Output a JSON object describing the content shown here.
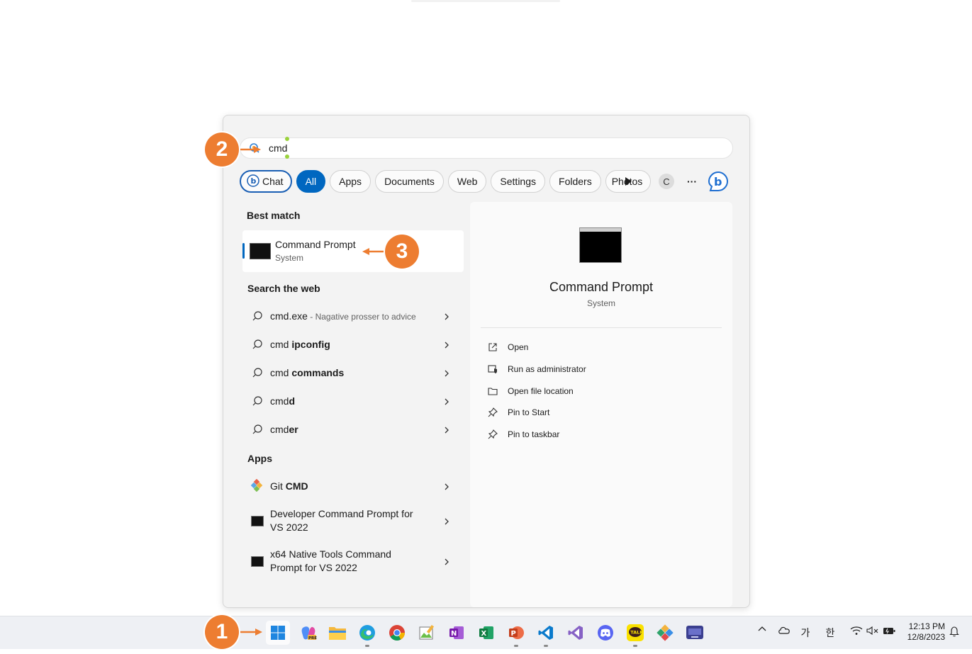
{
  "search": {
    "value": "cmd"
  },
  "filters": {
    "chat": "Chat",
    "items": [
      "All",
      "Apps",
      "Documents",
      "Web",
      "Settings",
      "Folders",
      "Photos"
    ],
    "extra_letter": "C",
    "more": "···"
  },
  "best_match": {
    "heading": "Best match",
    "title": "Command Prompt",
    "subtitle": "System"
  },
  "web": {
    "heading": "Search the web",
    "items": [
      {
        "prefix": "cmd.exe",
        "bold": "",
        "hint": " - Nagative prosser to advice"
      },
      {
        "prefix": "cmd ",
        "bold": "ipconfig",
        "hint": ""
      },
      {
        "prefix": "cmd ",
        "bold": "commands",
        "hint": ""
      },
      {
        "prefix": "cmd",
        "bold": "d",
        "hint": ""
      },
      {
        "prefix": "cmd",
        "bold": "er",
        "hint": ""
      }
    ]
  },
  "apps": {
    "heading": "Apps",
    "items": [
      {
        "line1_pre": "Git ",
        "line1_bold": "CMD",
        "line2": ""
      },
      {
        "line1_pre": "Developer Command Prompt for",
        "line1_bold": "",
        "line2": "VS 2022"
      },
      {
        "line1_pre": "x64 Native Tools Command",
        "line1_bold": "",
        "line2": "Prompt for VS 2022"
      }
    ]
  },
  "preview": {
    "title": "Command Prompt",
    "subtitle": "System",
    "actions": [
      "Open",
      "Run as administrator",
      "Open file location",
      "Pin to Start",
      "Pin to taskbar"
    ]
  },
  "callouts": [
    "1",
    "2",
    "3"
  ],
  "tray": {
    "ime1": "가",
    "ime2": "한",
    "time": "12:13 PM",
    "date": "12/8/2023"
  },
  "colors": {
    "accent": "#0067c0",
    "callout": "#ed7d31"
  }
}
